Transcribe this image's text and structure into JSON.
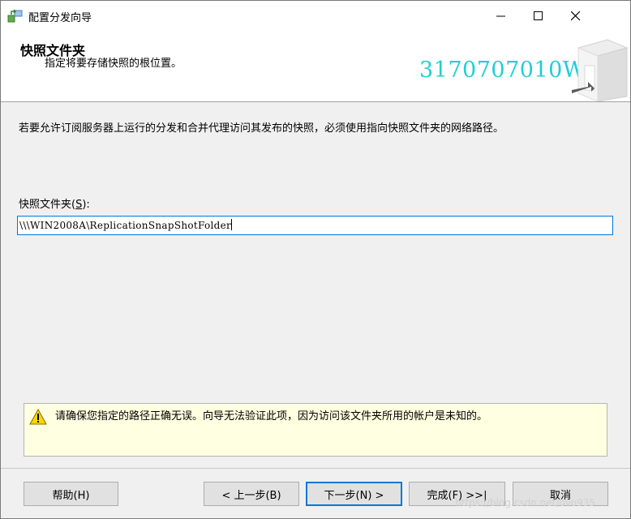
{
  "window": {
    "title": "配置分发向导"
  },
  "header": {
    "title": "快照文件夹",
    "subtitle": "指定将要存储快照的根位置。",
    "mark_text": "3170707010WDL"
  },
  "main": {
    "description": "若要允许订阅服务器上运行的分发和合并代理访问其发布的快照，必须使用指向快照文件夹的网络路径。",
    "field_label_prefix": "快照文件夹(",
    "field_label_accel": "S",
    "field_label_suffix": "):",
    "field_value": "\\\\\\WIN2008A\\ReplicationSnapShotFolder"
  },
  "warning": {
    "text": "请确保您指定的路径正确无误。向导无法验证此项，因为访问该文件夹所用的帐户是未知的。"
  },
  "buttons": {
    "help": "帮助(H)",
    "back": "< 上一步(B)",
    "next": "下一步(N) >",
    "finish": "完成(F) >>|",
    "cancel": "取消"
  },
  "watermark": "https://blog.csdn.net/ovo935"
}
